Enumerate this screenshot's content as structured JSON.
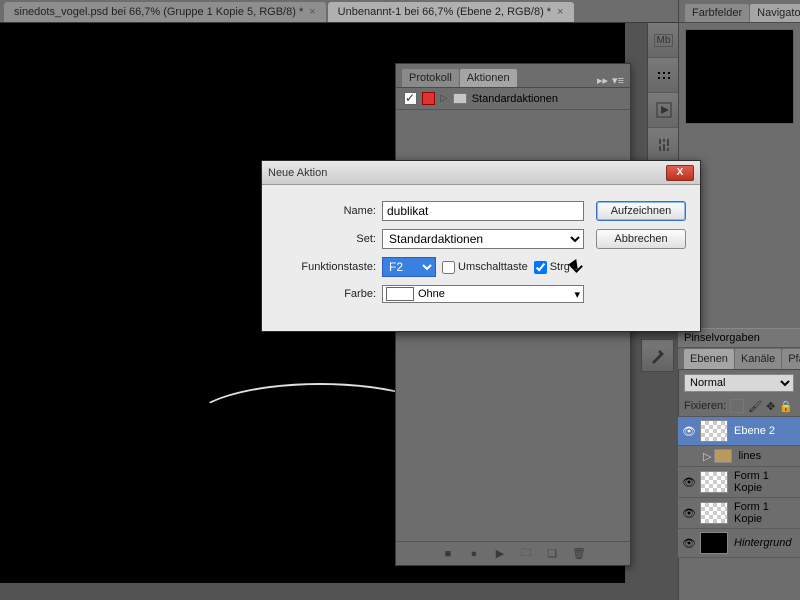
{
  "tabs": {
    "tab1": "sinedots_vogel.psd bei 66,7% (Gruppe 1 Kopie 5, RGB/8) *",
    "tab2": "Unbenannt-1 bei 66,7% (Ebene 2, RGB/8) *"
  },
  "rightTop": {
    "tab1": "Farbfelder",
    "tab2": "Navigator",
    "mb_icon": "Mb"
  },
  "brush": {
    "title": "Pinselvorgaben",
    "tabL": "Ebenen",
    "tabK": "Kanäle",
    "tabP": "Pfade",
    "blend": "Normal",
    "lock": "Fixieren:"
  },
  "layers": {
    "l1": "Ebene 2",
    "l2": "lines",
    "l3": "Form 1 Kopie",
    "l4": "Form 1 Kopie",
    "l5": "Hintergrund"
  },
  "actions": {
    "tab1": "Protokoll",
    "tab2": "Aktionen",
    "row1": "Standardaktionen"
  },
  "dialog": {
    "title": "Neue Aktion",
    "lblName": "Name:",
    "valName": "dublikat",
    "lblSet": "Set:",
    "valSet": "Standardaktionen",
    "lblFunc": "Funktionstaste:",
    "valFunc": "F2",
    "chkShift": "Umschalttaste",
    "chkCtrl": "Strg",
    "lblColor": "Farbe:",
    "valColor": "Ohne",
    "btnRecord": "Aufzeichnen",
    "btnCancel": "Abbrechen"
  }
}
